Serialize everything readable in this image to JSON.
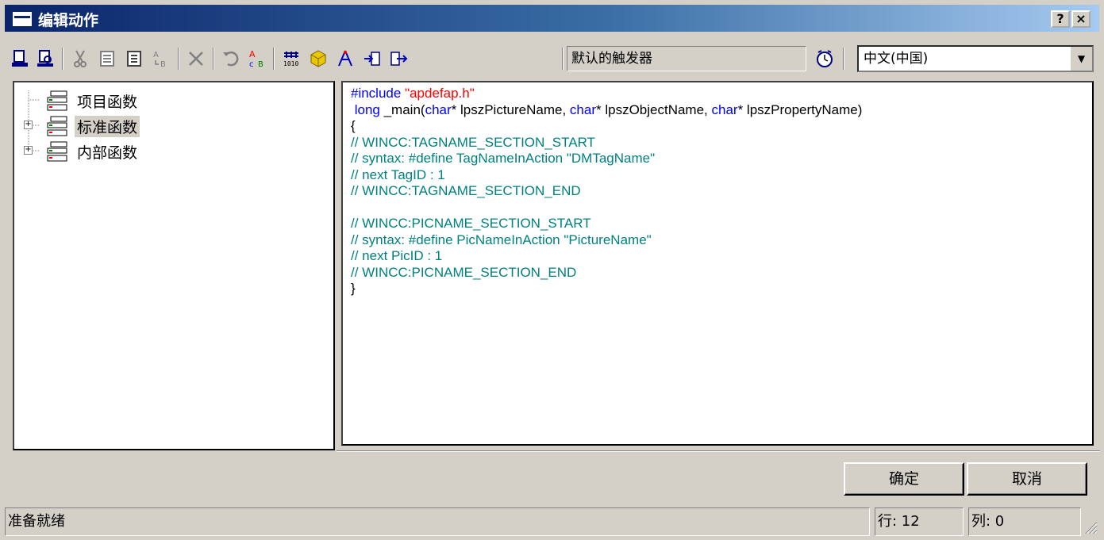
{
  "window": {
    "title": "编辑动作",
    "help_label": "?",
    "close_label": "×"
  },
  "toolbar": {
    "trigger_label": "默认的触发器",
    "language": "中文(中国)"
  },
  "tree": {
    "items": [
      {
        "label": "项目函数"
      },
      {
        "label": "标准函数"
      },
      {
        "label": "内部函数"
      }
    ]
  },
  "editor": {
    "lines": [
      {
        "parts": [
          {
            "t": "#include ",
            "c": "kw"
          },
          {
            "t": "\"apdefap.h\"",
            "c": "str"
          }
        ]
      },
      {
        "parts": [
          {
            "t": " long",
            "c": "kw"
          },
          {
            "t": " _main(",
            "c": ""
          },
          {
            "t": "char",
            "c": "kw"
          },
          {
            "t": "* lpszPictureName, ",
            "c": ""
          },
          {
            "t": "char",
            "c": "kw"
          },
          {
            "t": "* lpszObjectName, ",
            "c": ""
          },
          {
            "t": "char",
            "c": "kw"
          },
          {
            "t": "* lpszPropertyName)",
            "c": ""
          }
        ]
      },
      {
        "parts": [
          {
            "t": "{",
            "c": ""
          }
        ]
      },
      {
        "parts": [
          {
            "t": "// WINCC:TAGNAME_SECTION_START",
            "c": "cmt"
          }
        ]
      },
      {
        "parts": [
          {
            "t": "// syntax: #define TagNameInAction \"DMTagName\"",
            "c": "cmt"
          }
        ]
      },
      {
        "parts": [
          {
            "t": "// next TagID : 1",
            "c": "cmt"
          }
        ]
      },
      {
        "parts": [
          {
            "t": "// WINCC:TAGNAME_SECTION_END",
            "c": "cmt"
          }
        ]
      },
      {
        "parts": [
          {
            "t": "",
            "c": ""
          }
        ]
      },
      {
        "parts": [
          {
            "t": "// WINCC:PICNAME_SECTION_START",
            "c": "cmt"
          }
        ]
      },
      {
        "parts": [
          {
            "t": "// syntax: #define PicNameInAction \"PictureName\"",
            "c": "cmt"
          }
        ]
      },
      {
        "parts": [
          {
            "t": "// next PicID : 1",
            "c": "cmt"
          }
        ]
      },
      {
        "parts": [
          {
            "t": "// WINCC:PICNAME_SECTION_END",
            "c": "cmt"
          }
        ]
      },
      {
        "parts": [
          {
            "t": "}",
            "c": ""
          }
        ]
      }
    ]
  },
  "buttons": {
    "ok": "确定",
    "cancel": "取消"
  },
  "status": {
    "text": "准备就绪",
    "row": "行: 12",
    "col": "列: 0"
  }
}
